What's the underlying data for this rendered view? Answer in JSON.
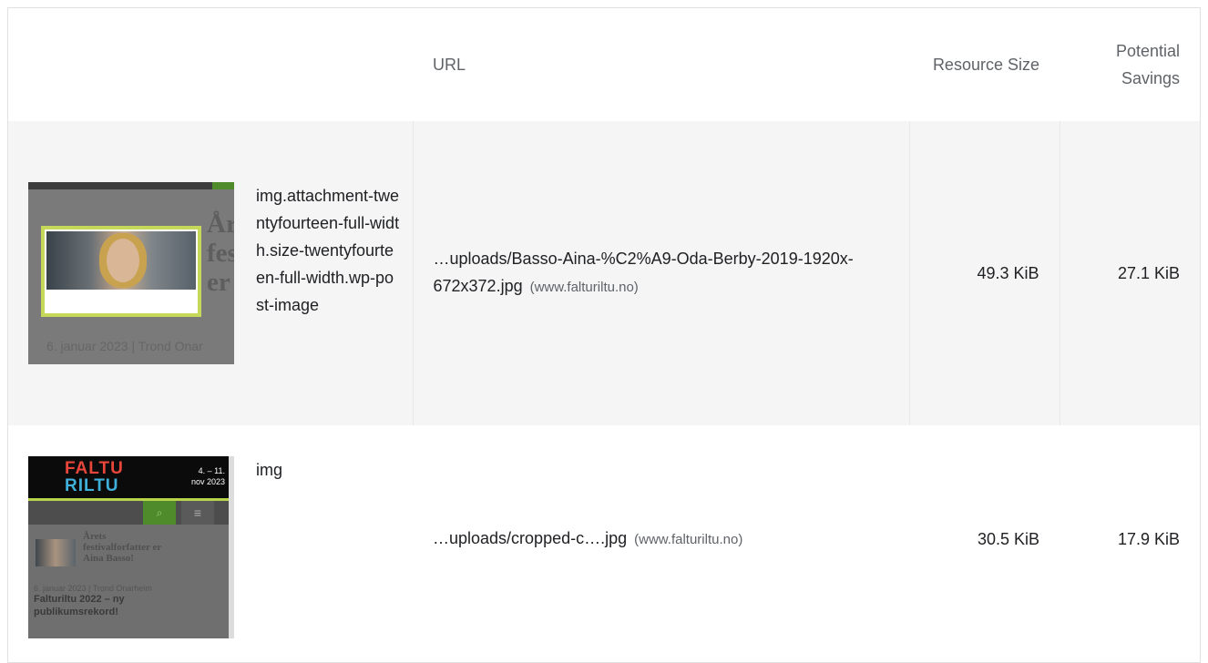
{
  "headers": {
    "url": "URL",
    "resource_size": "Resource Size",
    "potential_savings": "Potential Savings"
  },
  "rows": [
    {
      "node_label": "img.attachment-twentyfourteen-full-width.size-twentyfourteen-full-width.wp-post-image",
      "url": "…uploads/Basso-Aina-%C2%A9-Oda-Berby-2019-1920x-672x372.jpg",
      "origin": "(www.falturiltu.no)",
      "resource_size": "49.3 KiB",
      "potential_savings": "27.1 KiB",
      "thumbnail": {
        "headline": "Årets festivalf er Aina",
        "byline": "6. januar 2023 | Trond Onar"
      }
    },
    {
      "node_label": "img",
      "url": "…uploads/cropped-c….jpg",
      "origin": "(www.falturiltu.no)",
      "resource_size": "30.5 KiB",
      "potential_savings": "17.9 KiB",
      "thumbnail": {
        "logo_line1": "FALTU",
        "logo_line2": "RILTU",
        "dates": "4. – 11. nov 2023",
        "card_title": "Årets festivalforfatter er Aina Basso!",
        "card_date": "6. januar 2023 | Trond Onarheim",
        "card2_title": "Falturiltu 2022 – ny publikumsrekord!"
      }
    }
  ],
  "colors": {
    "row_alt_bg": "#f5f5f5",
    "header_text": "#5f6368",
    "highlight_border": "#c5d85a",
    "brand_green": "#4f8b2a"
  }
}
